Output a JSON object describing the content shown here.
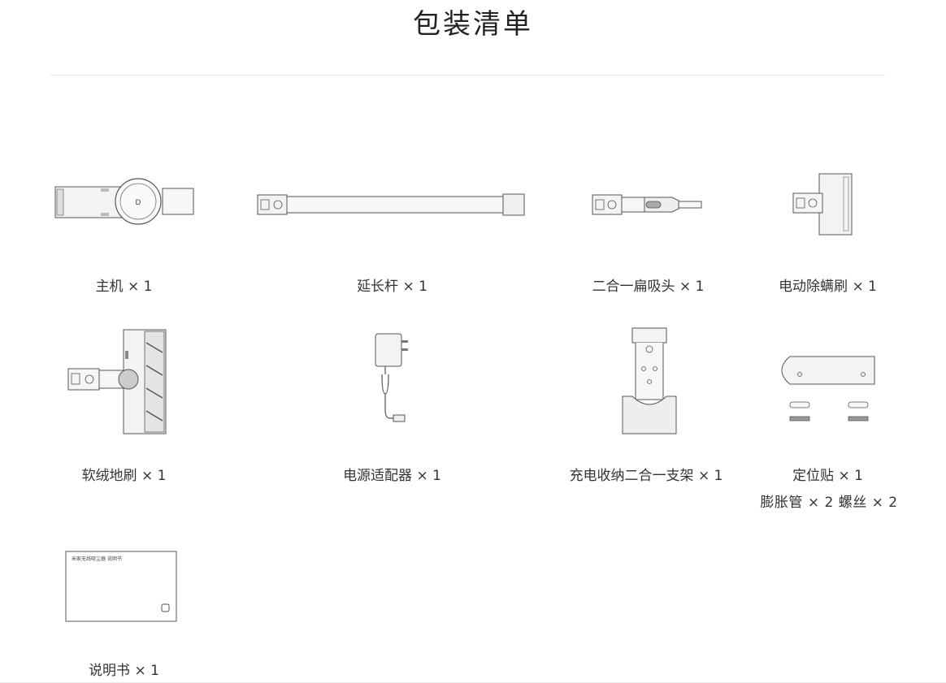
{
  "page": {
    "title": "包装清单"
  },
  "items": [
    {
      "label": "主机 × 1",
      "icon": "main-unit-icon"
    },
    {
      "label": "延长杆 × 1",
      "icon": "extension-rod-icon"
    },
    {
      "label": "二合一扁吸头 × 1",
      "icon": "2in1-flat-nozzle-icon"
    },
    {
      "label": "电动除螨刷 × 1",
      "icon": "electric-mite-brush-icon"
    },
    {
      "label": "软绒地刷 × 1",
      "icon": "soft-floor-brush-icon"
    },
    {
      "label": "电源适配器 × 1",
      "icon": "power-adapter-icon"
    },
    {
      "label": "充电收纳二合一支架 × 1",
      "icon": "charging-stand-icon"
    },
    {
      "label": "定位贴 × 1",
      "sublabel": "膨胀管 × 2 螺丝 × 2",
      "icon": "positioning-sticker-icon"
    },
    {
      "label": "说明书 × 1",
      "icon": "manual-icon",
      "manual_text": "米家无线吸尘器 说明书"
    }
  ]
}
